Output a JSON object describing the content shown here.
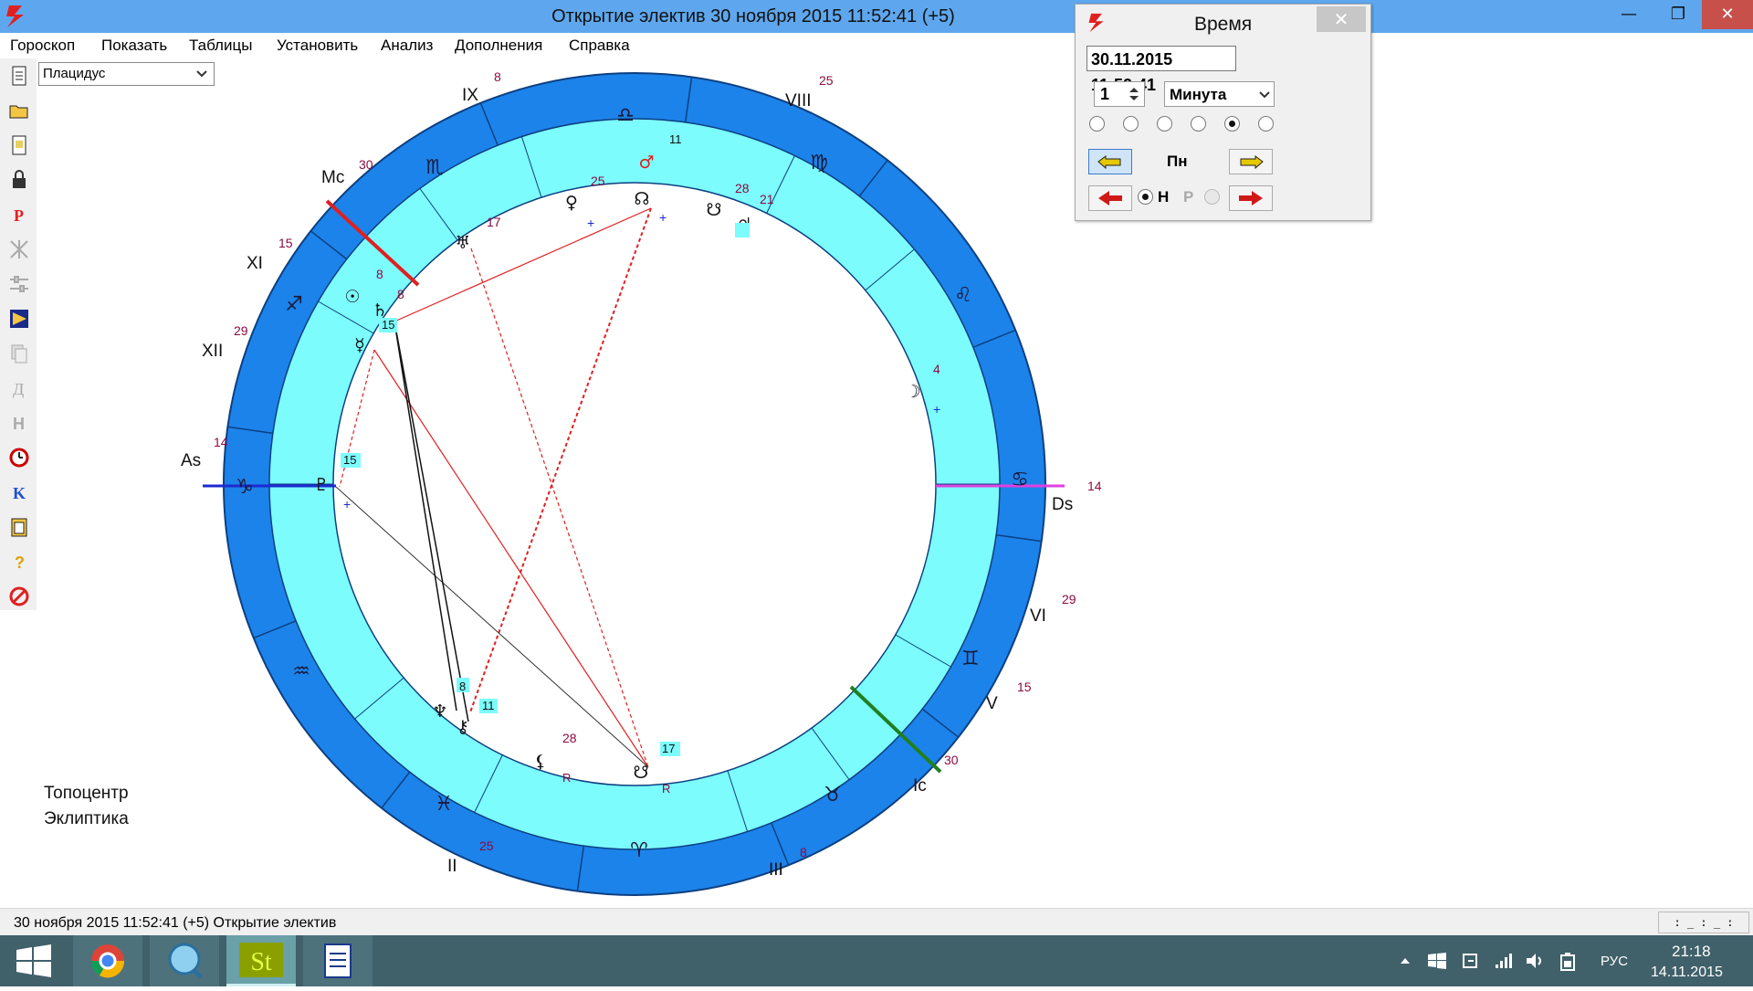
{
  "window": {
    "title": "Открытие электив 30 ноября 2015 11:52:41 (+5)"
  },
  "menu": [
    "Гороскоп",
    "Показать",
    "Таблицы",
    "Установить",
    "Анализ",
    "Дополнения",
    "Справка"
  ],
  "house_system": {
    "selected": "Плацидус"
  },
  "chart_labels": {
    "axes": {
      "asc": "As",
      "dsc": "Ds",
      "mc": "Mc",
      "ic": "Ic"
    },
    "house_numerals": [
      "XII",
      "XI",
      "IX",
      "VIII",
      "VI",
      "V",
      "III",
      "II"
    ],
    "house_degrees": [
      "29",
      "15",
      "30",
      "8",
      "25",
      "14",
      "29",
      "15",
      "30",
      "8",
      "25",
      "14"
    ],
    "planet_degrees": [
      "11",
      "25",
      "17",
      "28",
      "21",
      "4",
      "15",
      "8",
      "8",
      "11",
      "8",
      "28",
      "17",
      "15"
    ],
    "retro_mark": "R",
    "plus_mark": "+",
    "footer": [
      "Топоцентр",
      "Эклиптика"
    ]
  },
  "status": {
    "left": "30 ноября 2015  11:52:41 (+5)  Открытие электив",
    "box": ": _ : _ :"
  },
  "time_dialog": {
    "title": "Время",
    "datetime": "30.11.2015  11:52:41",
    "step": "1",
    "unit": "Минута",
    "weekday": "Пн",
    "mode_n": "Н",
    "mode_r": "Р",
    "radios_selected": 4
  },
  "tray": {
    "time": "21:18",
    "date": "14.11.2015",
    "lang": "РУС"
  },
  "colors": {
    "outer_ring": "#1c83ea",
    "inner_ring": "#7cfcfc",
    "titlebar": "#5ea7ee",
    "taskbar": "#40606a"
  }
}
